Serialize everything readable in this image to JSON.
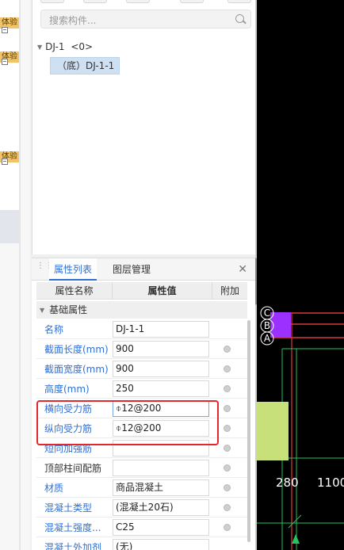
{
  "left_strip": {
    "badges": [
      "体验",
      "体验",
      "体验"
    ]
  },
  "component_panel": {
    "search": {
      "placeholder": "搜索构件..."
    },
    "tree": {
      "root_label": "DJ-1",
      "root_count": "<0>",
      "child_label": "（底）DJ-1-1"
    }
  },
  "attributes_panel": {
    "tabs": [
      "属性列表",
      "图层管理"
    ],
    "headers": {
      "name": "属性名称",
      "value": "属性值",
      "extra": "附加"
    },
    "group": "基础属性",
    "rows": [
      {
        "name": "名称",
        "value": "DJ-1-1",
        "name_color": "blue"
      },
      {
        "name": "截面长度(mm)",
        "value": "900",
        "name_color": "blue"
      },
      {
        "name": "截面宽度(mm)",
        "value": "900",
        "name_color": "blue"
      },
      {
        "name": "高度(mm)",
        "value": "250",
        "name_color": "blue"
      },
      {
        "name": "横向受力筋",
        "value": "⌽12@200",
        "name_color": "blue"
      },
      {
        "name": "纵向受力筋",
        "value": "⌽12@200",
        "name_color": "blue"
      },
      {
        "name": "短向加强筋",
        "value": "",
        "name_color": "blue"
      },
      {
        "name": "顶部柱间配筋",
        "value": "",
        "name_color": "black"
      },
      {
        "name": "材质",
        "value": "商品混凝土",
        "name_color": "blue"
      },
      {
        "name": "混凝土类型",
        "value": "(混凝土20石)",
        "name_color": "blue"
      },
      {
        "name": "混凝土强度...",
        "value": "C25",
        "name_color": "blue"
      },
      {
        "name": "混凝土外加剂",
        "value": "(无)",
        "name_color": "blue"
      }
    ]
  },
  "drawing": {
    "axis_labels": [
      "C",
      "B",
      "A"
    ],
    "dimensions": [
      "280",
      "1100"
    ],
    "colors": {
      "background": "#000000",
      "grid_red": "#d83a3a",
      "grid_green": "#22c55e",
      "column_purple": "#9b30ff",
      "footing_lime": "#c8e07a"
    }
  },
  "colors": {
    "accent_blue": "#2f6fd6",
    "highlight_red": "#e0282e",
    "badge_orange": "#f1c46a"
  }
}
